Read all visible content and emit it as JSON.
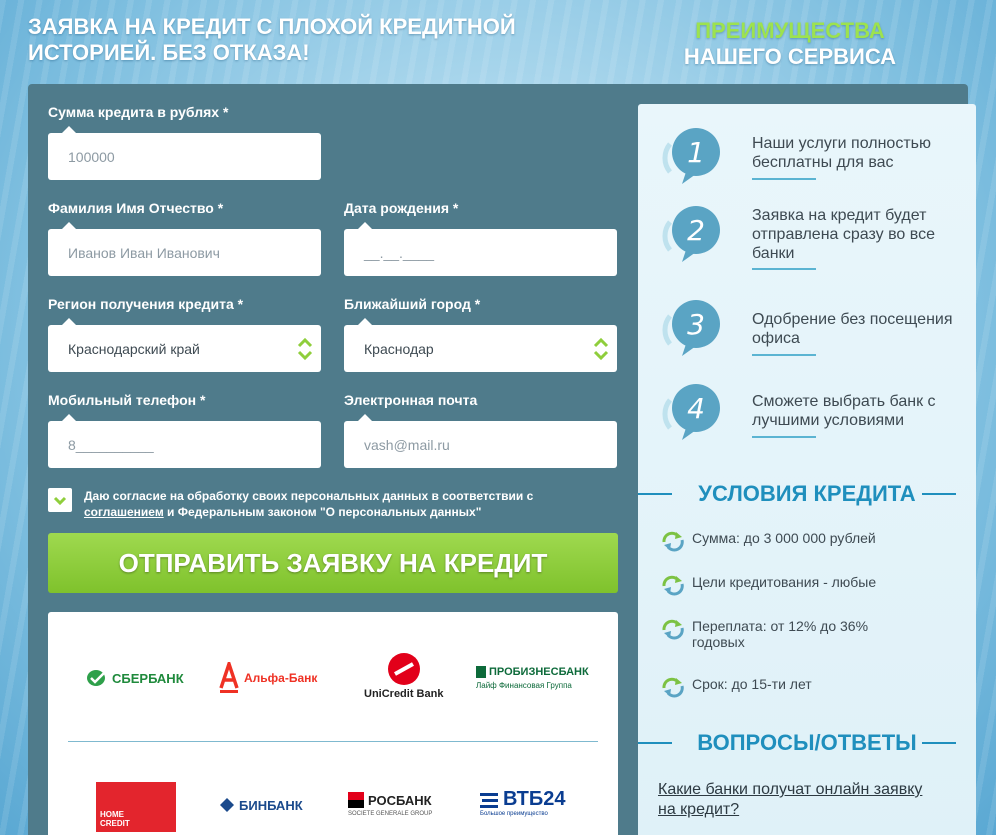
{
  "headline": "ЗАЯВКА НА КРЕДИТ С ПЛОХОЙ КРЕДИТНОЙ ИСТОРИЕЙ. БЕЗ ОТКАЗА!",
  "advantages_heading": {
    "line1": "ПРЕИМУЩЕСТВА",
    "line2": "НАШЕГО СЕРВИСА"
  },
  "form": {
    "amount": {
      "label": "Сумма кредита в рублях *",
      "placeholder": "100000"
    },
    "fio": {
      "label": "Фамилия Имя Отчество *",
      "placeholder": "Иванов Иван Иванович"
    },
    "birthdate": {
      "label": "Дата рождения *",
      "placeholder": "__.__.____"
    },
    "region": {
      "label": "Регион получения кредита *",
      "value": "Краснодарский край"
    },
    "city": {
      "label": "Ближайший город *",
      "value": "Краснодар"
    },
    "phone": {
      "label": "Мобильный телефон *",
      "placeholder": "8__________"
    },
    "email": {
      "label": "Электронная почта",
      "placeholder": "vash@mail.ru"
    },
    "consent": {
      "text_before": "Даю согласие на обработку своих персональных данных в соответствии с",
      "link": "соглашением",
      "text_after": "и Федеральным законом \"О персональных данных\"",
      "checked": true
    },
    "submit_label": "ОТПРАВИТЬ ЗАЯВКУ НА КРЕДИТ"
  },
  "banks": {
    "sberbank": "СБЕРБАНК",
    "alfa": "Альфа-Банк",
    "unicredit": "UniCredit Bank",
    "probusiness_top": "ПРОБИЗНЕСБАНК",
    "probusiness_bottom": "Лайф  Финансовая Группа",
    "homecredit": "HOME CREDIT",
    "binbank": "БИНБАНК",
    "rosbank": "РОСБАНК",
    "rosbank_sub": "SOCIETE GENERALE GROUP",
    "vtb": "ВТБ24",
    "vtb_sub": "Большое преимущество"
  },
  "advantages": [
    {
      "num": "1",
      "text": "Наши услуги полностью бесплатны для вас"
    },
    {
      "num": "2",
      "text": "Заявка на кредит будет отправлена сразу во все банки"
    },
    {
      "num": "3",
      "text": "Одобрение без посещения офиса"
    },
    {
      "num": "4",
      "text": "Сможете выбрать банк с лучшими условиями"
    }
  ],
  "conditions": {
    "title": "УСЛОВИЯ КРЕДИТА",
    "items": [
      "Сумма: до 3 000 000 рублей",
      "Цели кредитования - любые",
      "Переплата: от 12% до 36% годовых",
      "Срок: до 15-ти лет"
    ]
  },
  "faq": {
    "title": "ВОПРОСЫ/ОТВЕТЫ",
    "question": "Какие банки получат онлайн заявку на кредит?"
  },
  "colors": {
    "panel": "#4f7b8b",
    "accent_green": "#8fce3c",
    "accent_blue": "#1f8fbd"
  }
}
